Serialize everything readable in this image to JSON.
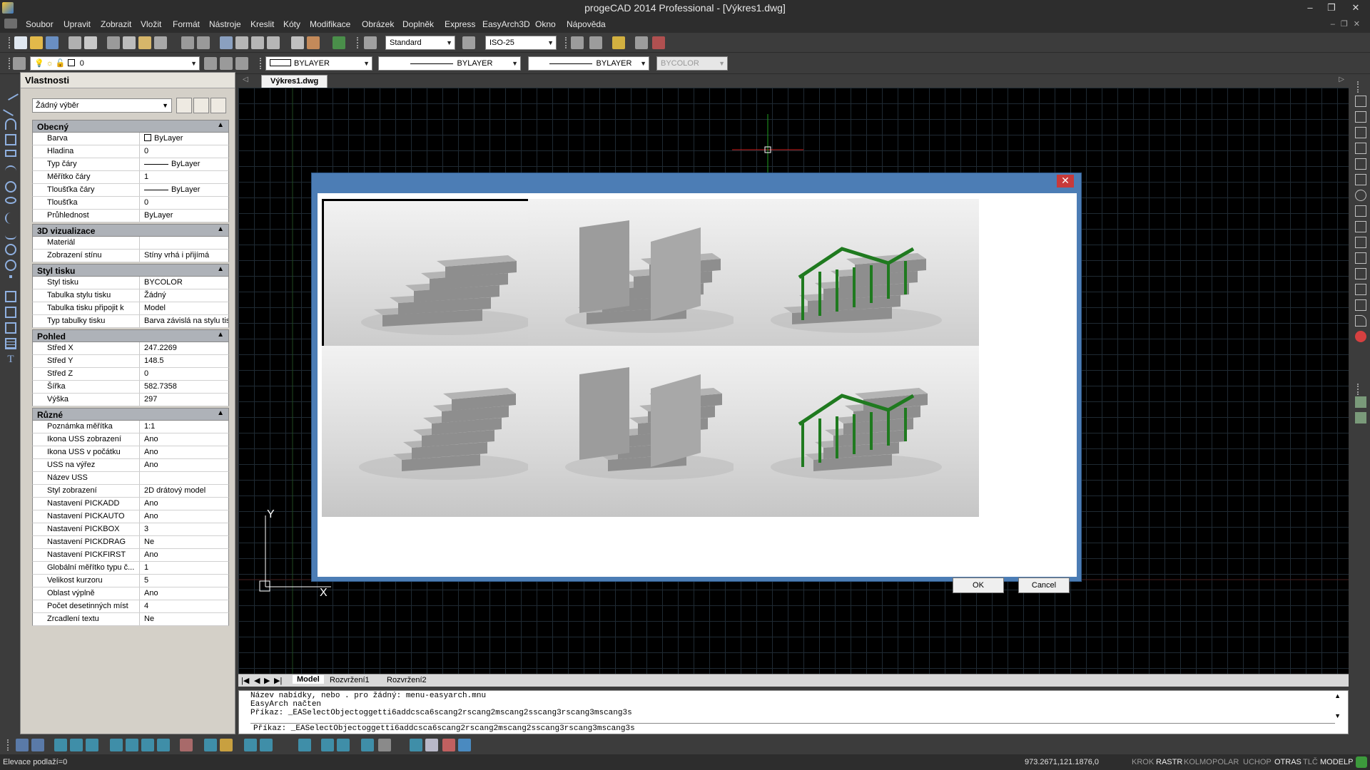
{
  "window": {
    "title": "progeCAD 2014 Professional - [Výkres1.dwg]",
    "min": "–",
    "restore": "❐",
    "close": "✕"
  },
  "menu": [
    "Soubor",
    "Upravit",
    "Zobrazit",
    "Vložit",
    "Formát",
    "Nástroje",
    "Kreslit",
    "Kóty",
    "Modifikace",
    "Obrázek",
    "Doplněk",
    "Express",
    "EasyArch3D",
    "Okno",
    "Nápověda"
  ],
  "toolbar": {
    "text_style": "Standard",
    "dim_style": "ISO-25",
    "layer": "0",
    "color": "BYLAYER",
    "linetype": "BYLAYER",
    "lineweight": "BYLAYER",
    "plotstyle": "BYCOLOR"
  },
  "properties": {
    "title": "Vlastnosti",
    "selection": "Žádný výběr",
    "categories": [
      {
        "name": "Obecný",
        "rows": [
          {
            "name": "Barva",
            "value": "ByLayer",
            "kind": "swatch"
          },
          {
            "name": "Hladina",
            "value": "0"
          },
          {
            "name": "Typ čáry",
            "value": "ByLayer",
            "kind": "line"
          },
          {
            "name": "Měřítko čáry",
            "value": "1"
          },
          {
            "name": "Tloušťka čáry",
            "value": "ByLayer",
            "kind": "line"
          },
          {
            "name": "Tloušťka",
            "value": "0"
          },
          {
            "name": "Průhlednost",
            "value": "ByLayer"
          }
        ]
      },
      {
        "name": "3D vizualizace",
        "rows": [
          {
            "name": "Materiál",
            "value": ""
          },
          {
            "name": "Zobrazení stínu",
            "value": "Stíny vrhá i přijímá"
          }
        ]
      },
      {
        "name": "Styl tisku",
        "rows": [
          {
            "name": "Styl tisku",
            "value": "BYCOLOR"
          },
          {
            "name": "Tabulka stylu tisku",
            "value": "Žádný"
          },
          {
            "name": "Tabulka tisku připojit k",
            "value": "Model"
          },
          {
            "name": "Typ tabulky tisku",
            "value": "Barva závislá na stylu tis..."
          }
        ]
      },
      {
        "name": "Pohled",
        "rows": [
          {
            "name": "Střed X",
            "value": "247.2269"
          },
          {
            "name": "Střed Y",
            "value": "148.5"
          },
          {
            "name": "Střed Z",
            "value": "0"
          },
          {
            "name": "Šířka",
            "value": "582.7358"
          },
          {
            "name": "Výška",
            "value": "297"
          }
        ]
      },
      {
        "name": "Různé",
        "rows": [
          {
            "name": "Poznámka měřítka",
            "value": "1:1"
          },
          {
            "name": "Ikona USS zobrazení",
            "value": "Ano"
          },
          {
            "name": "Ikona USS v počátku",
            "value": "Ano"
          },
          {
            "name": "USS na výřez",
            "value": "Ano"
          },
          {
            "name": "Název USS",
            "value": ""
          },
          {
            "name": "Styl zobrazení",
            "value": "2D drátový model"
          },
          {
            "name": "Nastavení PICKADD",
            "value": "Ano"
          },
          {
            "name": "Nastavení PICKAUTO",
            "value": "Ano"
          },
          {
            "name": "Nastavení PICKBOX",
            "value": "3"
          },
          {
            "name": "Nastavení PICKDRAG",
            "value": "Ne"
          },
          {
            "name": "Nastavení PICKFIRST",
            "value": "Ano"
          },
          {
            "name": "Globální měřítko typu č...",
            "value": "1"
          },
          {
            "name": "Velikost kurzoru",
            "value": "5"
          },
          {
            "name": "Oblast výplně",
            "value": "Ano"
          },
          {
            "name": "Počet desetinných míst",
            "value": "4"
          },
          {
            "name": "Zrcadlení textu",
            "value": "Ne"
          }
        ]
      }
    ]
  },
  "document_tab": "Výkres1.dwg",
  "layout_tabs": [
    "Model",
    "Rozvržení1",
    "Rozvržení2"
  ],
  "ucs": {
    "x": "X",
    "y": "Y"
  },
  "command": {
    "history": [
      "Název nabídky, nebo . pro žádný: menu-easyarch.mnu",
      "EasyArch načten",
      "Příkaz: _EASelectObjectoggetti6addcsca6scang2rscang2mscang2sscang3rscang3mscang3s"
    ],
    "prompt": "Příkaz: _EASelectObjectoggetti6addcsca6scang2rscang2mscang2sscang3rscang3mscang3s"
  },
  "status": {
    "left": "Elevace podlaží=0",
    "coords": "973.2671,121.1876,0",
    "buttons": [
      "KROK",
      "RASTR",
      "KOLMO",
      "POLAR",
      "UCHOP",
      "OTRAS",
      "TLČ",
      "MODELP"
    ]
  },
  "dialog": {
    "close": "✕",
    "ok": "OK",
    "cancel": "Cancel",
    "thumbnails": [
      "stair-straight-flight",
      "stair-with-walls",
      "stair-with-railing",
      "stair-spiral-flight",
      "stair-spiral-with-walls",
      "stair-spiral-with-railing"
    ],
    "selected_index": 0,
    "railing_color": "#1f7a1f"
  },
  "colors": {
    "canvas": "#000000",
    "dialog_frame": "#4c7db5",
    "crosshair_x": "#d02020",
    "crosshair_y": "#20a020"
  }
}
